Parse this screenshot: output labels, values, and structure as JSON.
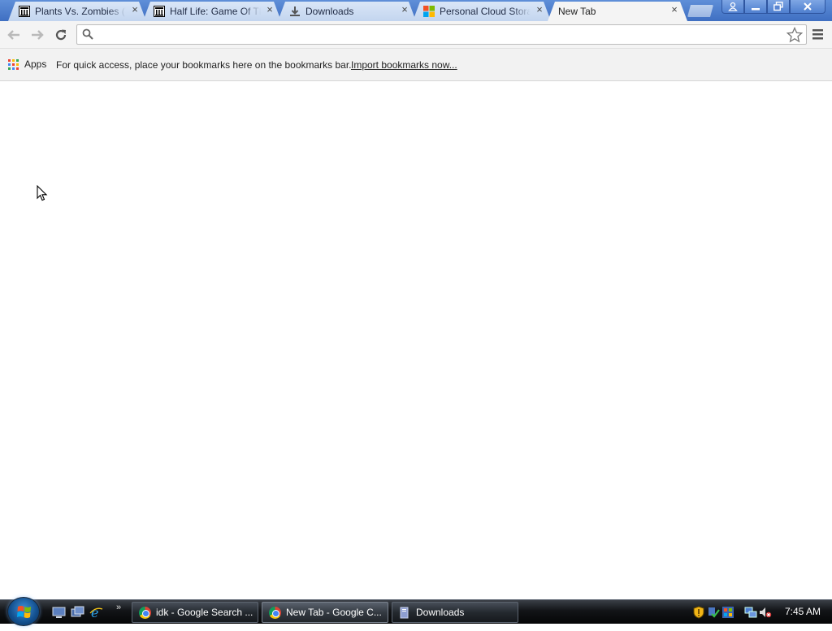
{
  "browser": {
    "tabs": [
      {
        "title": "Plants Vs. Zombies (T",
        "favicon": "archive-pillar-icon",
        "active": false
      },
      {
        "title": "Half Life: Game Of Th",
        "favicon": "archive-pillar-icon",
        "active": false
      },
      {
        "title": "Downloads",
        "favicon": "download-icon",
        "active": false
      },
      {
        "title": "Personal Cloud Storag",
        "favicon": "microsoft-icon",
        "active": false
      },
      {
        "title": "New Tab",
        "favicon": "none",
        "active": true
      }
    ],
    "tab_close_glyph": "×",
    "window_controls": [
      "profile-icon",
      "minimize-icon",
      "restore-icon",
      "close-icon"
    ],
    "toolbar": {
      "back": "back-arrow-icon",
      "forward": "forward-arrow-icon",
      "reload": "reload-icon",
      "omnibox_value": "",
      "omnibox_placeholder": "",
      "star": "star-icon",
      "menu": "hamburger-menu-icon"
    },
    "bookmarks_bar": {
      "apps_label": "Apps",
      "hint_text": "For quick access, place your bookmarks here on the bookmarks bar.",
      "import_link": "Import bookmarks now..."
    }
  },
  "taskbar": {
    "quick_launch": [
      "show-desktop-icon",
      "switch-windows-icon",
      "internet-explorer-icon"
    ],
    "quick_launch_more": "»",
    "buttons": [
      {
        "label": "idk - Google Search ...",
        "icon": "chrome-icon",
        "active": false
      },
      {
        "label": "New Tab - Google C...",
        "icon": "chrome-icon",
        "active": true
      },
      {
        "label": "Downloads",
        "icon": "folder-icon",
        "active": false
      }
    ],
    "tray_icons": [
      "security-shield-icon",
      "network-check-icon",
      "windows-update-icon",
      "network-icon",
      "volume-muted-icon"
    ],
    "clock": "7:45 AM"
  },
  "colors": {
    "titlebar": "#4a7acb",
    "tab_inactive": "#c8d9f1",
    "tab_active": "#f4f4f4",
    "taskbar": "#121417"
  }
}
